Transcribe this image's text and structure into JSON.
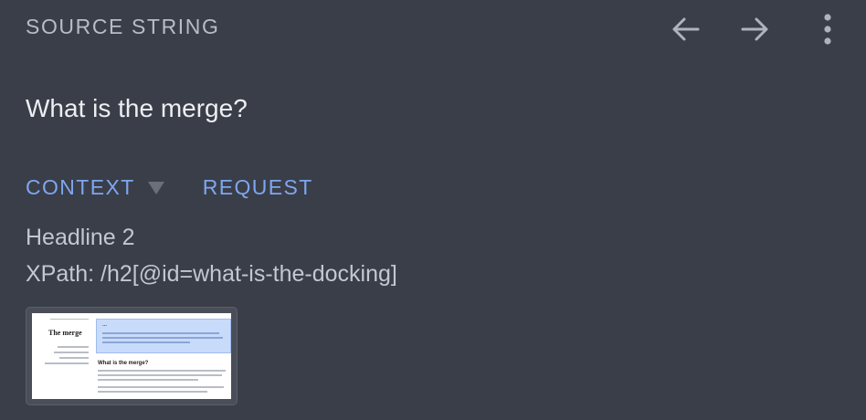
{
  "header": {
    "title": "SOURCE STRING",
    "icons": {
      "back": "arrow-left-icon",
      "forward": "arrow-right-icon",
      "more": "more-vertical-icon"
    }
  },
  "source": {
    "text": "What is the merge?"
  },
  "tabs": [
    {
      "label": "CONTEXT"
    },
    {
      "label": "REQUEST"
    }
  ],
  "context": {
    "element_type": "Headline 2",
    "xpath": "XPath: /h2[@id=what-is-the-docking]"
  },
  "thumbnail": {
    "page_title": "The merge",
    "highlight_title": "...",
    "section_title": "What is the merge?"
  },
  "colors": {
    "background": "#3a3e48",
    "accent": "#7ea6f0",
    "muted_text": "#b7bcc6"
  }
}
